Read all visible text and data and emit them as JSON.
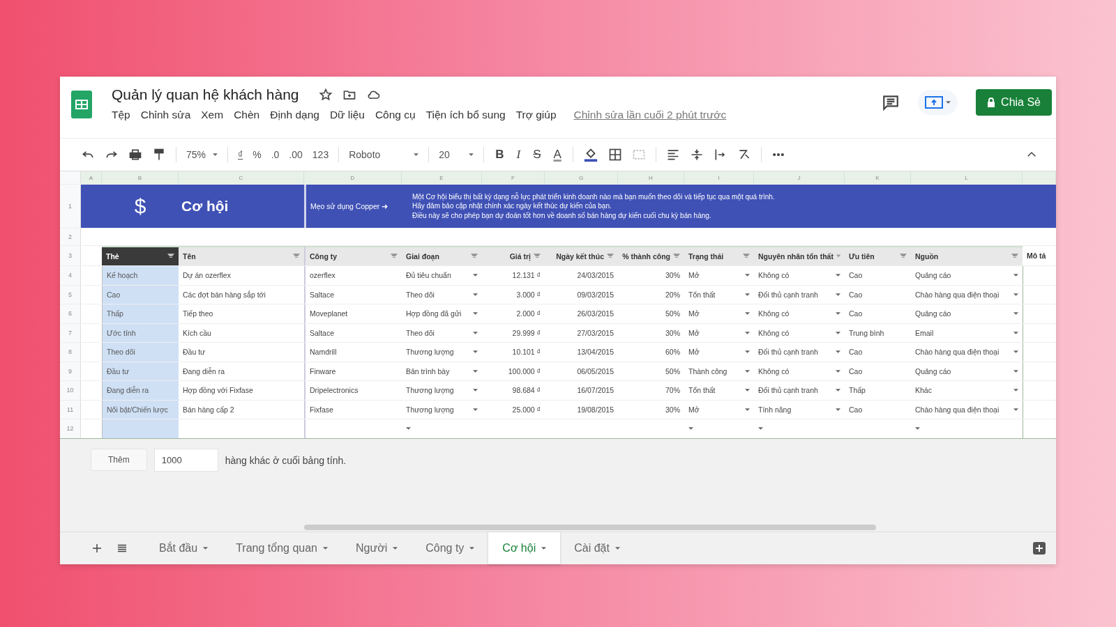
{
  "document": {
    "title": "Quản lý quan hệ khách hàng",
    "menu": [
      "Tệp",
      "Chỉnh sửa",
      "Xem",
      "Chèn",
      "Định dạng",
      "Dữ liệu",
      "Công cụ",
      "Tiện ích bổ sung",
      "Trợ giúp"
    ],
    "last_edit": "Chỉnh sửa lần cuối 2 phút trước",
    "share_button": "Chia Sẻ"
  },
  "toolbar": {
    "zoom": "75%",
    "format_items": [
      "₫",
      "%",
      ".0",
      ".00",
      "123"
    ],
    "font": "Roboto",
    "font_size": "20",
    "text_styles": [
      "B",
      "I",
      "S",
      "A"
    ]
  },
  "column_letters": [
    "A",
    "B",
    "C",
    "D",
    "E",
    "F",
    "G",
    "H",
    "I",
    "J",
    "K",
    "L"
  ],
  "row_numbers": [
    "1",
    "2",
    "3",
    "4",
    "5",
    "6",
    "7",
    "8",
    "9",
    "10",
    "11",
    "12"
  ],
  "banner": {
    "icon": "$",
    "title": "Cơ hội",
    "tip_label": "Mẹo sử dụng Copper ➜",
    "tip_lines": [
      "Một Cơ hội biểu thị bất kỳ dạng nỗ lực phát triển kinh doanh nào mà bạn muốn theo dõi và tiếp tục qua một quá trình.",
      "Hãy đảm bảo cập nhật chính xác ngày kết thúc dự kiến của bạn.",
      "Điều này sẽ cho phép bạn dự đoán tốt hơn về doanh số bán hàng dự kiến cuối chu kỳ bán hàng."
    ]
  },
  "table": {
    "columns": [
      {
        "label": "Thẻ",
        "kind": "tag",
        "filter": true
      },
      {
        "label": "Tên",
        "kind": "text",
        "filter": true
      },
      {
        "label": "Công ty",
        "kind": "text",
        "filter": true
      },
      {
        "label": "Giai đoạn",
        "kind": "dropdown",
        "filter": true
      },
      {
        "label": "Giá trị",
        "kind": "number",
        "filter": true
      },
      {
        "label": "Ngày kết thúc",
        "kind": "number",
        "filter": true
      },
      {
        "label": "% thành công",
        "kind": "number",
        "filter": true
      },
      {
        "label": "Trạng thái",
        "kind": "dropdown",
        "filter": true
      },
      {
        "label": "Nguyên nhân tổn thất",
        "kind": "dropdown",
        "filter": true
      },
      {
        "label": "Ưu tiên",
        "kind": "text",
        "filter": true
      },
      {
        "label": "Nguồn",
        "kind": "dropdown",
        "filter": true
      },
      {
        "label": "Mô tả",
        "kind": "text",
        "filter": false
      }
    ],
    "rows": [
      {
        "cells": [
          "Kế hoạch",
          "Dự án ozerflex",
          "ozerflex",
          "Đủ tiêu chuẩn",
          "12.131 ₫",
          "24/03/2015",
          "30%",
          "Mở",
          "Không có",
          "Cao",
          "Quảng cáo"
        ]
      },
      {
        "cells": [
          "Cao",
          "Các đợt bán hàng sắp tới",
          "Saltace",
          "Theo dõi",
          "3.000 ₫",
          "09/03/2015",
          "20%",
          "Tổn thất",
          "Đối thủ cạnh tranh",
          "Cao",
          "Chào hàng qua điện thoại"
        ]
      },
      {
        "cells": [
          "Thấp",
          "Tiếp theo",
          "Moveplanet",
          "Hợp đồng đã gửi",
          "2.000 ₫",
          "26/03/2015",
          "50%",
          "Mở",
          "Không có",
          "Cao",
          "Quảng cáo"
        ]
      },
      {
        "cells": [
          "Ước tính",
          "Kích cầu",
          "Saltace",
          "Theo dõi",
          "29.999 ₫",
          "27/03/2015",
          "30%",
          "Mở",
          "Không có",
          "Trung bình",
          "Email"
        ]
      },
      {
        "cells": [
          "Theo dõi",
          "Đầu tư",
          "Namdrill",
          "Thương lượng",
          "10.101 ₫",
          "13/04/2015",
          "60%",
          "Mở",
          "Đối thủ cạnh tranh",
          "Cao",
          "Chào hàng qua điện thoại"
        ]
      },
      {
        "cells": [
          "Đầu tư",
          "Đang diễn ra",
          "Finware",
          "Bản trình bày",
          "100.000 ₫",
          "06/05/2015",
          "50%",
          "Thành công",
          "Không có",
          "Cao",
          "Quảng cáo"
        ]
      },
      {
        "cells": [
          "Đang diễn ra",
          "Hợp đồng với Fixfase",
          "Dripelectronics",
          "Thương lượng",
          "98.684 ₫",
          "16/07/2015",
          "70%",
          "Tổn thất",
          "Đối thủ cạnh tranh",
          "Thấp",
          "Khác"
        ]
      },
      {
        "cells": [
          "Nổi bật/Chiến lược",
          "Bán hàng cấp 2",
          "Fixfase",
          "Thương lượng",
          "25.000 ₫",
          "19/08/2015",
          "30%",
          "Mở",
          "Tính năng",
          "Cao",
          "Chào hàng qua điện thoại"
        ]
      }
    ]
  },
  "add_rows": {
    "button": "Thêm",
    "value": "1000",
    "text": "hàng khác ở cuối bảng tính."
  },
  "sheet_tabs": [
    {
      "label": "Bắt đầu",
      "selected": false
    },
    {
      "label": "Trang tổng quan",
      "selected": false
    },
    {
      "label": "Người",
      "selected": false
    },
    {
      "label": "Công ty",
      "selected": false
    },
    {
      "label": "Cơ hội",
      "selected": true
    },
    {
      "label": "Cài đặt",
      "selected": false
    }
  ]
}
